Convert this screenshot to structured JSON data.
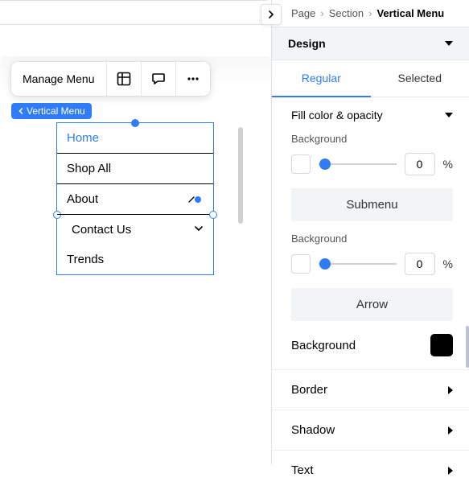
{
  "toolbar": {
    "label": "Manage Menu"
  },
  "tag": {
    "label": "Vertical Menu"
  },
  "menu": {
    "items": [
      {
        "label": "Home"
      },
      {
        "label": "Shop All"
      },
      {
        "label": "About"
      },
      {
        "label": "Contact Us"
      },
      {
        "label": "Trends"
      }
    ]
  },
  "breadcrumb": {
    "a": "Page",
    "b": "Section",
    "c": "Vertical Menu"
  },
  "accordion": {
    "design": "Design"
  },
  "tabs": {
    "regular": "Regular",
    "selected": "Selected"
  },
  "fill": {
    "title": "Fill color & opacity",
    "bg_label": "Background",
    "value": "0",
    "unit": "%"
  },
  "submenu": {
    "header": "Submenu",
    "bg_label": "Background",
    "value": "0",
    "unit": "%"
  },
  "arrow": {
    "header": "Arrow",
    "bg_label": "Background"
  },
  "rows": {
    "border": "Border",
    "shadow": "Shadow",
    "text": "Text"
  },
  "colors": {
    "accent": "#2f7cf6",
    "arrow_bg": "#000000"
  }
}
